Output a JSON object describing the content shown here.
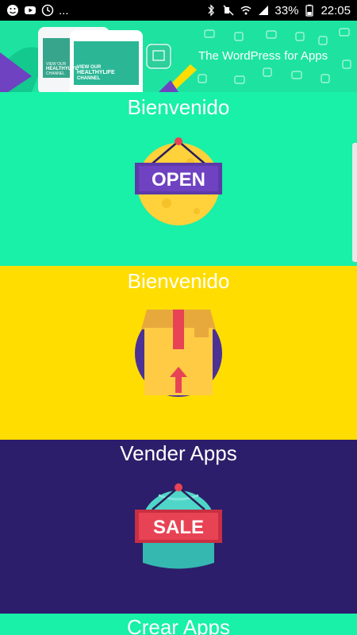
{
  "status_bar": {
    "battery": "33%",
    "time": "22:05",
    "notif_more": "..."
  },
  "header": {
    "tagline": "The WordPress for Apps",
    "tablet_text_1": "VIEW OUR HEALTHYLIFE CHANNEL",
    "tablet_text_2": "VIEW OUR HEALTHYLIFE CHANNEL"
  },
  "sections": [
    {
      "title": "Bienvenido",
      "bg": "#19f0a8",
      "sign_label": "OPEN"
    },
    {
      "title": "Bienvenido",
      "bg": "#ffdd00"
    },
    {
      "title": "Vender Apps",
      "bg": "#2c1e6a",
      "sign_label": "SALE"
    },
    {
      "title": "Crear Apps",
      "bg": "#19f0a8"
    }
  ],
  "colors": {
    "accent_purple": "#6f42c1",
    "sale_red": "#e84355"
  },
  "icons": [
    "smiley-icon",
    "youtube-icon",
    "clock-icon",
    "bluetooth-icon",
    "mute-icon",
    "wifi-icon",
    "signal-icon",
    "battery-icon"
  ]
}
